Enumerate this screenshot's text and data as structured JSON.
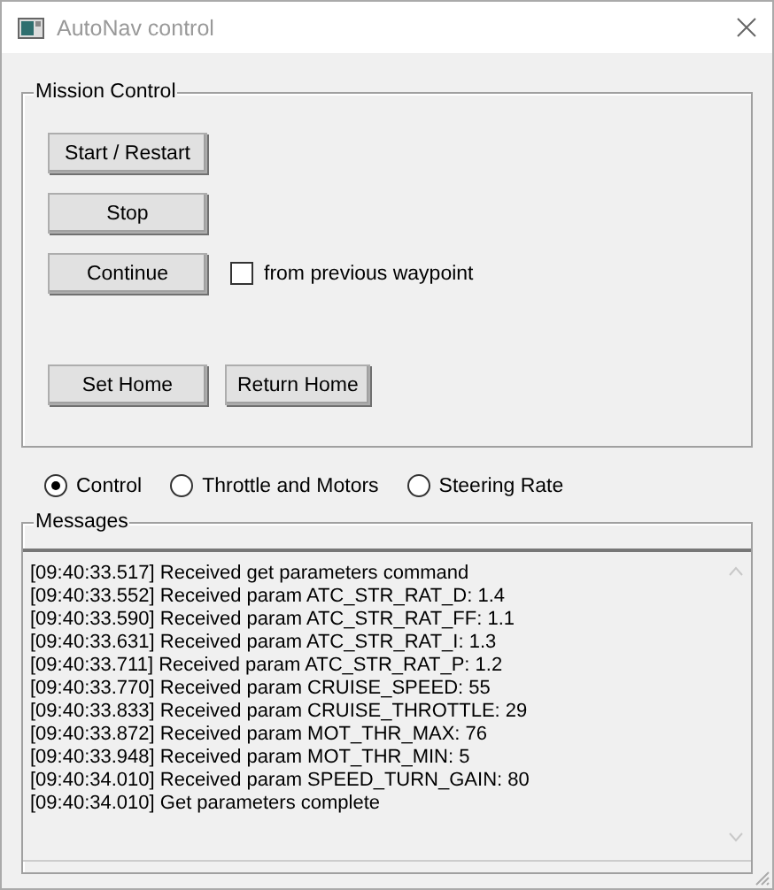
{
  "window": {
    "title": "AutoNav control"
  },
  "mission_control": {
    "title": "Mission Control",
    "button_rows": [
      [
        {
          "label": "Start / Restart"
        }
      ],
      [
        {
          "label": "Stop"
        }
      ],
      [
        {
          "label": "Continue"
        }
      ],
      [
        {
          "label": "Set Home"
        },
        {
          "label": "Return Home"
        }
      ]
    ],
    "checkbox": {
      "label": "from previous waypoint",
      "checked": false
    }
  },
  "modes": [
    {
      "label": "Control",
      "selected": true
    },
    {
      "label": "Throttle and Motors",
      "selected": false
    },
    {
      "label": "Steering Rate",
      "selected": false
    }
  ],
  "messages": {
    "title": "Messages",
    "lines": [
      "[09:40:33.517] Received get parameters command",
      "[09:40:33.552] Received param ATC_STR_RAT_D: 1.4",
      "[09:40:33.590] Received param ATC_STR_RAT_FF: 1.1",
      "[09:40:33.631] Received param ATC_STR_RAT_I: 1.3",
      "[09:40:33.711] Received param ATC_STR_RAT_P: 1.2",
      "[09:40:33.770] Received param CRUISE_SPEED: 55",
      "[09:40:33.833] Received param CRUISE_THROTTLE: 29",
      "[09:40:33.872] Received param MOT_THR_MAX: 76",
      "[09:40:33.948] Received param MOT_THR_MIN: 5",
      "[09:40:34.010] Received param SPEED_TURN_GAIN: 80",
      "[09:40:34.010] Get parameters complete"
    ]
  }
}
